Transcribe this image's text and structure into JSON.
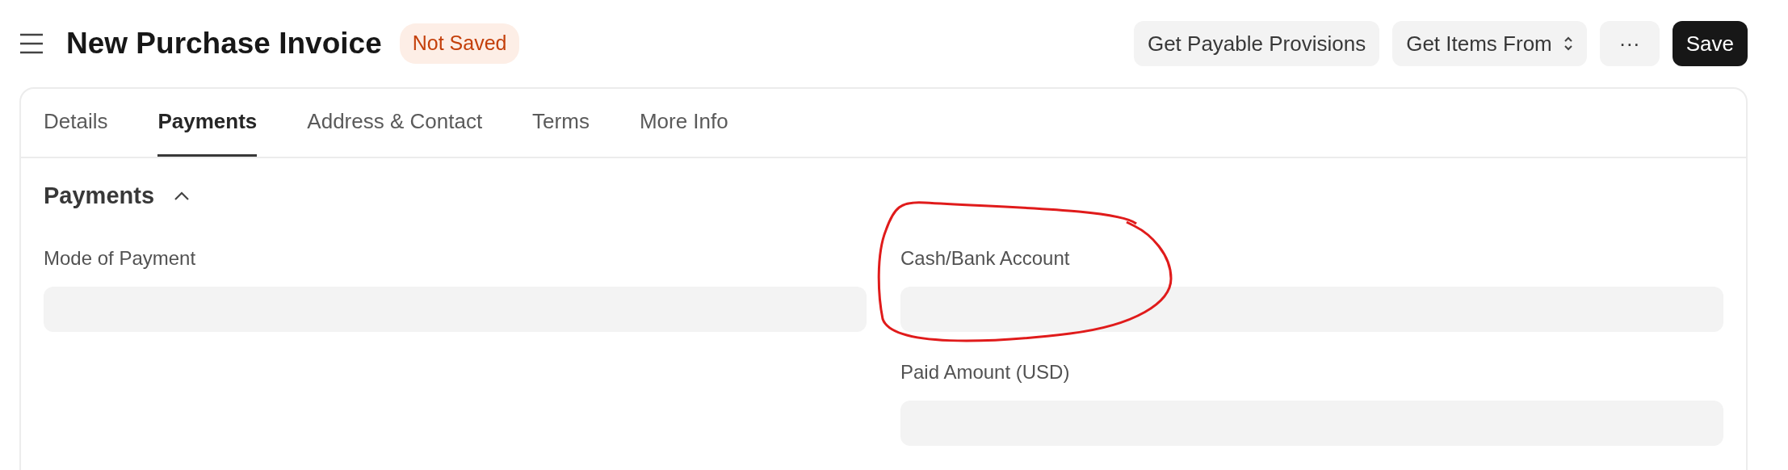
{
  "header": {
    "title": "New Purchase Invoice",
    "status_badge": "Not Saved"
  },
  "actions": [
    {
      "kind": "button",
      "label": "Get Payable Provisions"
    },
    {
      "kind": "dropdown",
      "label": "Get Items From"
    },
    {
      "kind": "more",
      "label": "···"
    },
    {
      "kind": "primary",
      "label": "Save"
    }
  ],
  "tabs": [
    {
      "label": "Details",
      "selected": false
    },
    {
      "label": "Payments",
      "selected": true
    },
    {
      "label": "Address & Contact",
      "selected": false
    },
    {
      "label": "Terms",
      "selected": false
    },
    {
      "label": "More Info",
      "selected": false
    }
  ],
  "section": {
    "title": "Payments",
    "expanded": true,
    "left_fields": [
      {
        "label": "Mode of Payment"
      }
    ],
    "right_fields": [
      {
        "label": "Cash/Bank Account",
        "annotated": true
      },
      {
        "label": "Paid Amount (USD)"
      }
    ]
  }
}
